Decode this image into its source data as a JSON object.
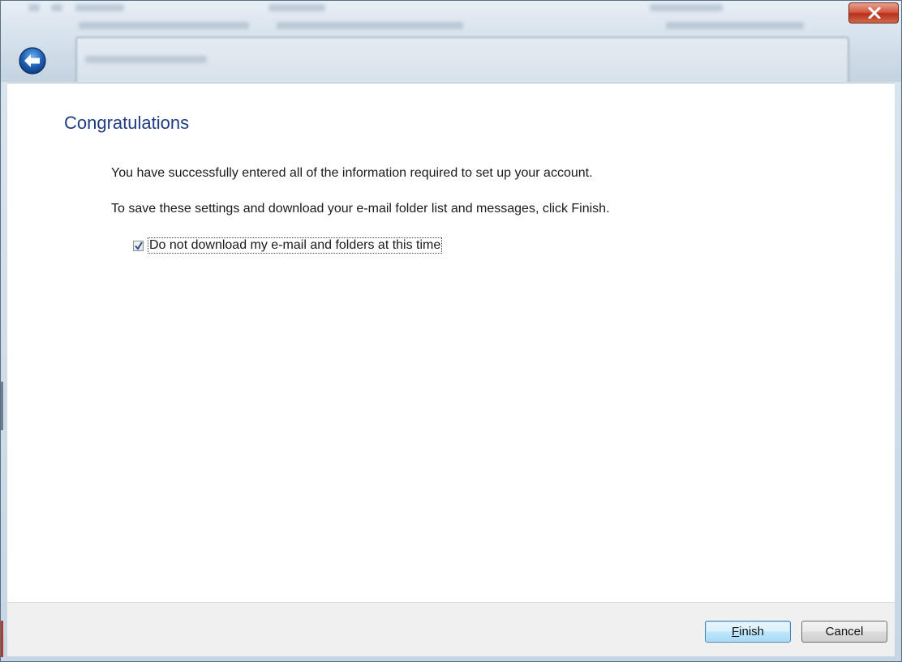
{
  "dialog": {
    "title": "Congratulations",
    "message_1": "You have successfully entered all of the information required to set up your account.",
    "message_2": "To save these settings and download your e-mail folder list and messages, click Finish.",
    "checkbox": {
      "label": "Do not download my e-mail and folders at this time",
      "checked": true
    }
  },
  "buttons": {
    "finish_label_accel": "F",
    "finish_label_rest": "inish",
    "cancel_label": "Cancel"
  },
  "titlebar": {
    "close_icon": "close-icon",
    "back_icon": "back-arrow-icon"
  },
  "colors": {
    "title_text": "#1f3d80",
    "close_button": "#c8432b",
    "back_button": "#1e5fb4"
  }
}
